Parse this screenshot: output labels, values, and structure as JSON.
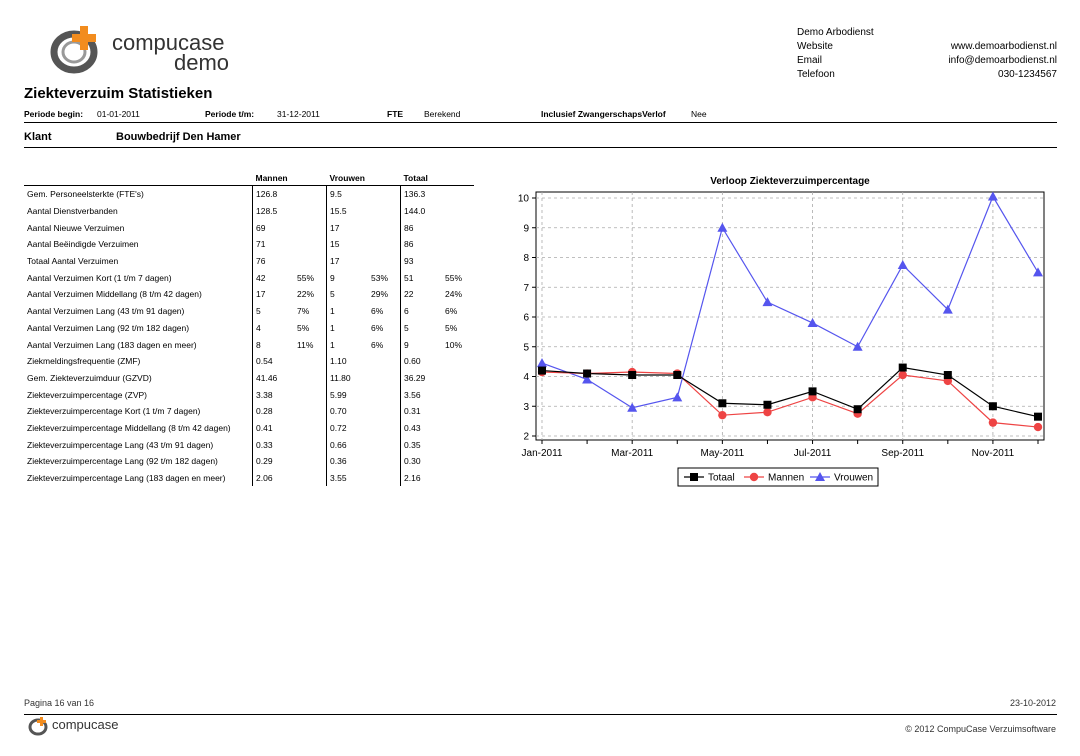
{
  "logo": {
    "line1": "compucase",
    "line2": "demo"
  },
  "company": {
    "name": "Demo Arbodienst",
    "rows": [
      {
        "label": "Website",
        "value": "www.demoarbodienst.nl"
      },
      {
        "label": "Email",
        "value": "info@demoarbodienst.nl"
      },
      {
        "label": "Telefoon",
        "value": "030-1234567"
      }
    ]
  },
  "title": "Ziekteverzuim Statistieken",
  "header": {
    "periode_begin_label": "Periode begin:",
    "periode_begin": "01-01-2011",
    "periode_tm_label": "Periode t/m:",
    "periode_tm": "31-12-2011",
    "fte_label": "FTE",
    "fte": "Berekend",
    "zwanger_label": "Inclusief ZwangerschapsVerlof",
    "zwanger": "Nee"
  },
  "klant": {
    "label": "Klant",
    "name": "Bouwbedrijf Den Hamer"
  },
  "table": {
    "headers": [
      "Mannen",
      "Vrouwen",
      "Totaal"
    ],
    "rows": [
      {
        "label": "Gem. Personeelsterkte (FTE's)",
        "m": "126.8",
        "mp": "",
        "v": "9.5",
        "vp": "",
        "t": "136.3",
        "tp": ""
      },
      {
        "label": "Aantal Dienstverbanden",
        "m": "128.5",
        "mp": "",
        "v": "15.5",
        "vp": "",
        "t": "144.0",
        "tp": ""
      },
      {
        "label": "Aantal Nieuwe Verzuimen",
        "m": "69",
        "mp": "",
        "v": "17",
        "vp": "",
        "t": "86",
        "tp": ""
      },
      {
        "label": "Aantal Beëindigde Verzuimen",
        "m": "71",
        "mp": "",
        "v": "15",
        "vp": "",
        "t": "86",
        "tp": ""
      },
      {
        "label": "Totaal Aantal Verzuimen",
        "m": "76",
        "mp": "",
        "v": "17",
        "vp": "",
        "t": "93",
        "tp": ""
      },
      {
        "label": "Aantal Verzuimen Kort (1 t/m 7 dagen)",
        "m": "42",
        "mp": "55%",
        "v": "9",
        "vp": "53%",
        "t": "51",
        "tp": "55%"
      },
      {
        "label": "Aantal Verzuimen Middellang (8 t/m 42 dagen)",
        "m": "17",
        "mp": "22%",
        "v": "5",
        "vp": "29%",
        "t": "22",
        "tp": "24%"
      },
      {
        "label": "Aantal Verzuimen Lang (43 t/m 91 dagen)",
        "m": "5",
        "mp": "7%",
        "v": "1",
        "vp": "6%",
        "t": "6",
        "tp": "6%"
      },
      {
        "label": "Aantal Verzuimen Lang (92 t/m 182 dagen)",
        "m": "4",
        "mp": "5%",
        "v": "1",
        "vp": "6%",
        "t": "5",
        "tp": "5%"
      },
      {
        "label": "Aantal Verzuimen Lang (183 dagen en meer)",
        "m": "8",
        "mp": "11%",
        "v": "1",
        "vp": "6%",
        "t": "9",
        "tp": "10%"
      },
      {
        "label": "Ziekmeldingsfrequentie (ZMF)",
        "m": "0.54",
        "mp": "",
        "v": "1.10",
        "vp": "",
        "t": "0.60",
        "tp": ""
      },
      {
        "label": "Gem. Ziekteverzuimduur (GZVD)",
        "m": "41.46",
        "mp": "",
        "v": "11.80",
        "vp": "",
        "t": "36.29",
        "tp": ""
      },
      {
        "label": "Ziekteverzuimpercentage (ZVP)",
        "m": "3.38",
        "mp": "",
        "v": "5.99",
        "vp": "",
        "t": "3.56",
        "tp": ""
      },
      {
        "label": "Ziekteverzuimpercentage Kort (1 t/m 7 dagen)",
        "m": "0.28",
        "mp": "",
        "v": "0.70",
        "vp": "",
        "t": "0.31",
        "tp": ""
      },
      {
        "label": "Ziekteverzuimpercentage Middellang (8 t/m 42 dagen)",
        "m": "0.41",
        "mp": "",
        "v": "0.72",
        "vp": "",
        "t": "0.43",
        "tp": ""
      },
      {
        "label": "Ziekteverzuimpercentage Lang (43 t/m 91 dagen)",
        "m": "0.33",
        "mp": "",
        "v": "0.66",
        "vp": "",
        "t": "0.35",
        "tp": ""
      },
      {
        "label": "Ziekteverzuimpercentage Lang (92 t/m 182 dagen)",
        "m": "0.29",
        "mp": "",
        "v": "0.36",
        "vp": "",
        "t": "0.30",
        "tp": ""
      },
      {
        "label": "Ziekteverzuimpercentage Lang (183 dagen en meer)",
        "m": "2.06",
        "mp": "",
        "v": "3.55",
        "vp": "",
        "t": "2.16",
        "tp": ""
      }
    ]
  },
  "chart_data": {
    "type": "line",
    "title": "Verloop Ziekteverzuimpercentage",
    "x": [
      "Jan-2011",
      "Feb-2011",
      "Mar-2011",
      "Apr-2011",
      "May-2011",
      "Jun-2011",
      "Jul-2011",
      "Aug-2011",
      "Sep-2011",
      "Oct-2011",
      "Nov-2011",
      "Dec-2011"
    ],
    "x_tick_labels": [
      "Jan-2011",
      "Mar-2011",
      "May-2011",
      "Jul-2011",
      "Sep-2011",
      "Nov-2011"
    ],
    "ylim": [
      2,
      10
    ],
    "y_ticks": [
      2,
      3,
      4,
      5,
      6,
      7,
      8,
      9,
      10
    ],
    "grid": true,
    "legend": "bottom",
    "series": [
      {
        "name": "Totaal",
        "color": "#000000",
        "marker": "square",
        "values": [
          4.2,
          4.1,
          4.05,
          4.05,
          3.1,
          3.05,
          3.5,
          2.9,
          4.3,
          4.05,
          3.0,
          2.65
        ]
      },
      {
        "name": "Mannen",
        "color": "#ee4444",
        "marker": "circle",
        "values": [
          4.15,
          4.1,
          4.15,
          4.1,
          2.7,
          2.8,
          3.3,
          2.75,
          4.05,
          3.85,
          2.45,
          2.3
        ]
      },
      {
        "name": "Vrouwen",
        "color": "#5555ee",
        "marker": "triangle",
        "values": [
          4.45,
          3.9,
          2.95,
          3.3,
          9.0,
          6.5,
          5.8,
          5.0,
          7.75,
          6.25,
          10.05,
          7.5
        ]
      }
    ]
  },
  "footer": {
    "page": "Pagina 16 van 16",
    "date": "23-10-2012",
    "logo": "compucase",
    "copyright": "© 2012 CompuCase Verzuimsoftware"
  }
}
